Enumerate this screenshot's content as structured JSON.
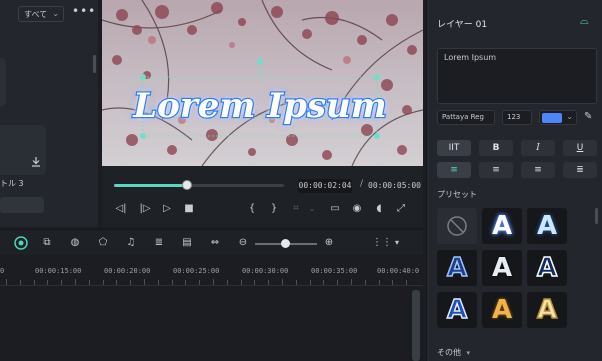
{
  "left_panel": {
    "filter_label": "すべて",
    "more_label": "•••",
    "media_item_label": "トル 3"
  },
  "preview": {
    "overlay_text": "Lorem Ipsum",
    "playback_progress": 0.43,
    "current_time": "00:00:02:04",
    "time_separator": "/",
    "total_time": "00:00:05:00"
  },
  "properties": {
    "layer_title": "レイヤー 01",
    "text_content": "Lorem Ipsum",
    "font_name": "Pattaya Reg",
    "font_size": "123",
    "text_color": "#4f86f7",
    "format_buttons": [
      "IIT",
      "B",
      "I",
      "U"
    ],
    "align_buttons": [
      "align-left",
      "align-center",
      "align-right",
      "align-justify"
    ],
    "preset_label": "プリセット",
    "other_label": "その他"
  },
  "timeline": {
    "ruler_labels": [
      "0",
      "00:00:15:00",
      "00:00:20:00",
      "00:00:25:00",
      "00:00:30:00",
      "00:00:35:00",
      "00:00:40:0"
    ]
  },
  "colors": {
    "accent": "#5ad7c0",
    "text_color_swatch": "#4f86f7",
    "panel_bg": "#23262c"
  }
}
